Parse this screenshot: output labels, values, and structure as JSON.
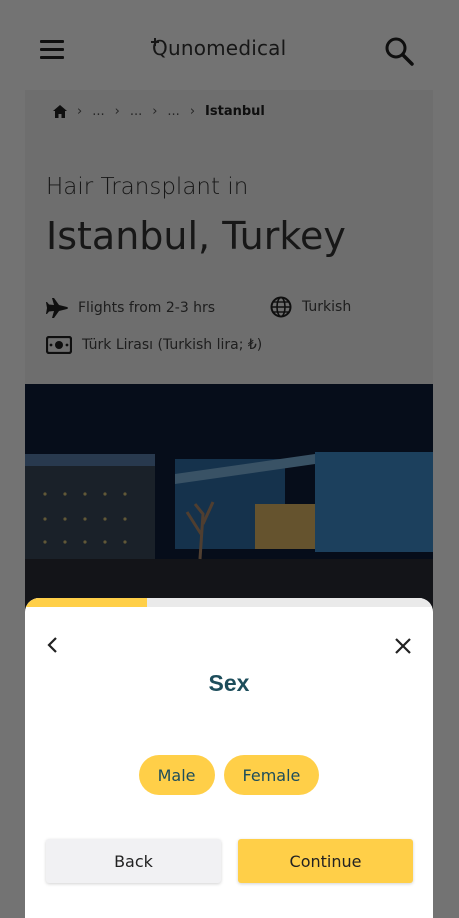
{
  "header": {
    "logo_text": "Qunomedical",
    "menu_icon": "hamburger-menu-icon",
    "search_icon": "search-icon"
  },
  "breadcrumb": {
    "items": [
      "...",
      "...",
      "..."
    ],
    "current": "Istanbul"
  },
  "hero": {
    "title_line1": "Hair Transplant in",
    "title_line2": "Istanbul, Turkey",
    "flights": "Flights from 2-3 hrs",
    "language": "Turkish",
    "currency": "Türk Lirası (Turkish lira; ₺)"
  },
  "modal": {
    "progress_fraction": 0.3,
    "title": "Sex",
    "options": [
      "Male",
      "Female"
    ],
    "back_label": "Back",
    "continue_label": "Continue"
  },
  "colors": {
    "accent_yellow": "#ffcf48",
    "title_teal": "#1d4d5b",
    "overlay": "rgba(0,0,0,0.55)"
  }
}
